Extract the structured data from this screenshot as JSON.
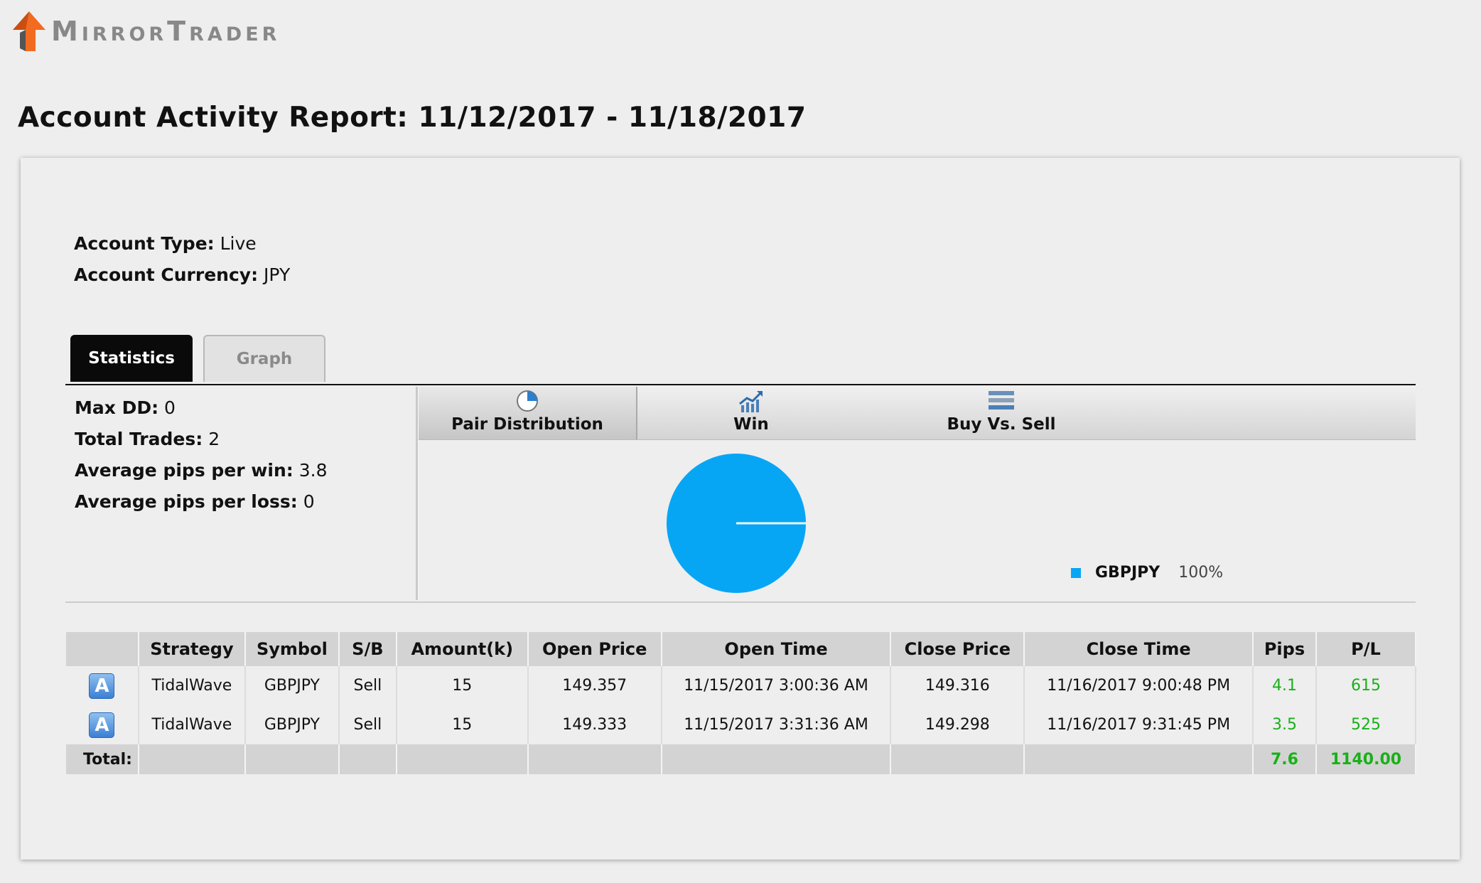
{
  "brand": {
    "name": "MirrorTrader",
    "accent": "#f26b21"
  },
  "report": {
    "title": "Account Activity Report: 11/12/2017 - 11/18/2017"
  },
  "account": {
    "type_label": "Account Type:",
    "type_value": "Live",
    "currency_label": "Account Currency:",
    "currency_value": "JPY"
  },
  "tabs": {
    "statistics": "Statistics",
    "graph": "Graph"
  },
  "stats": [
    {
      "label": "Max DD:",
      "value": "0"
    },
    {
      "label": "Total Trades:",
      "value": "2"
    },
    {
      "label": "Average pips per win:",
      "value": "3.8"
    },
    {
      "label": "Average pips per loss:",
      "value": "0"
    }
  ],
  "subtabs": {
    "pair_distribution": "Pair Distribution",
    "win": "Win",
    "buy_vs_sell": "Buy Vs. Sell"
  },
  "chart_data": {
    "type": "pie",
    "series": [
      {
        "name": "GBPJPY",
        "value": 100,
        "label": "100%",
        "color": "#07a6f5"
      }
    ]
  },
  "table": {
    "headers": [
      "",
      "Strategy",
      "Symbol",
      "S/B",
      "Amount(k)",
      "Open Price",
      "Open Time",
      "Close Price",
      "Close Time",
      "Pips",
      "P/L"
    ],
    "rows": [
      {
        "badge": "A",
        "strategy": "TidalWave",
        "symbol": "GBPJPY",
        "side": "Sell",
        "amount": "15",
        "open_price": "149.357",
        "open_time": "11/15/2017 3:00:36 AM",
        "close_price": "149.316",
        "close_time": "11/16/2017 9:00:48 PM",
        "pips": "4.1",
        "pl": "615"
      },
      {
        "badge": "A",
        "strategy": "TidalWave",
        "symbol": "GBPJPY",
        "side": "Sell",
        "amount": "15",
        "open_price": "149.333",
        "open_time": "11/15/2017 3:31:36 AM",
        "close_price": "149.298",
        "close_time": "11/16/2017 9:31:45 PM",
        "pips": "3.5",
        "pl": "525"
      }
    ],
    "total": {
      "label": "Total:",
      "pips": "7.6",
      "pl": "1140.00"
    }
  }
}
